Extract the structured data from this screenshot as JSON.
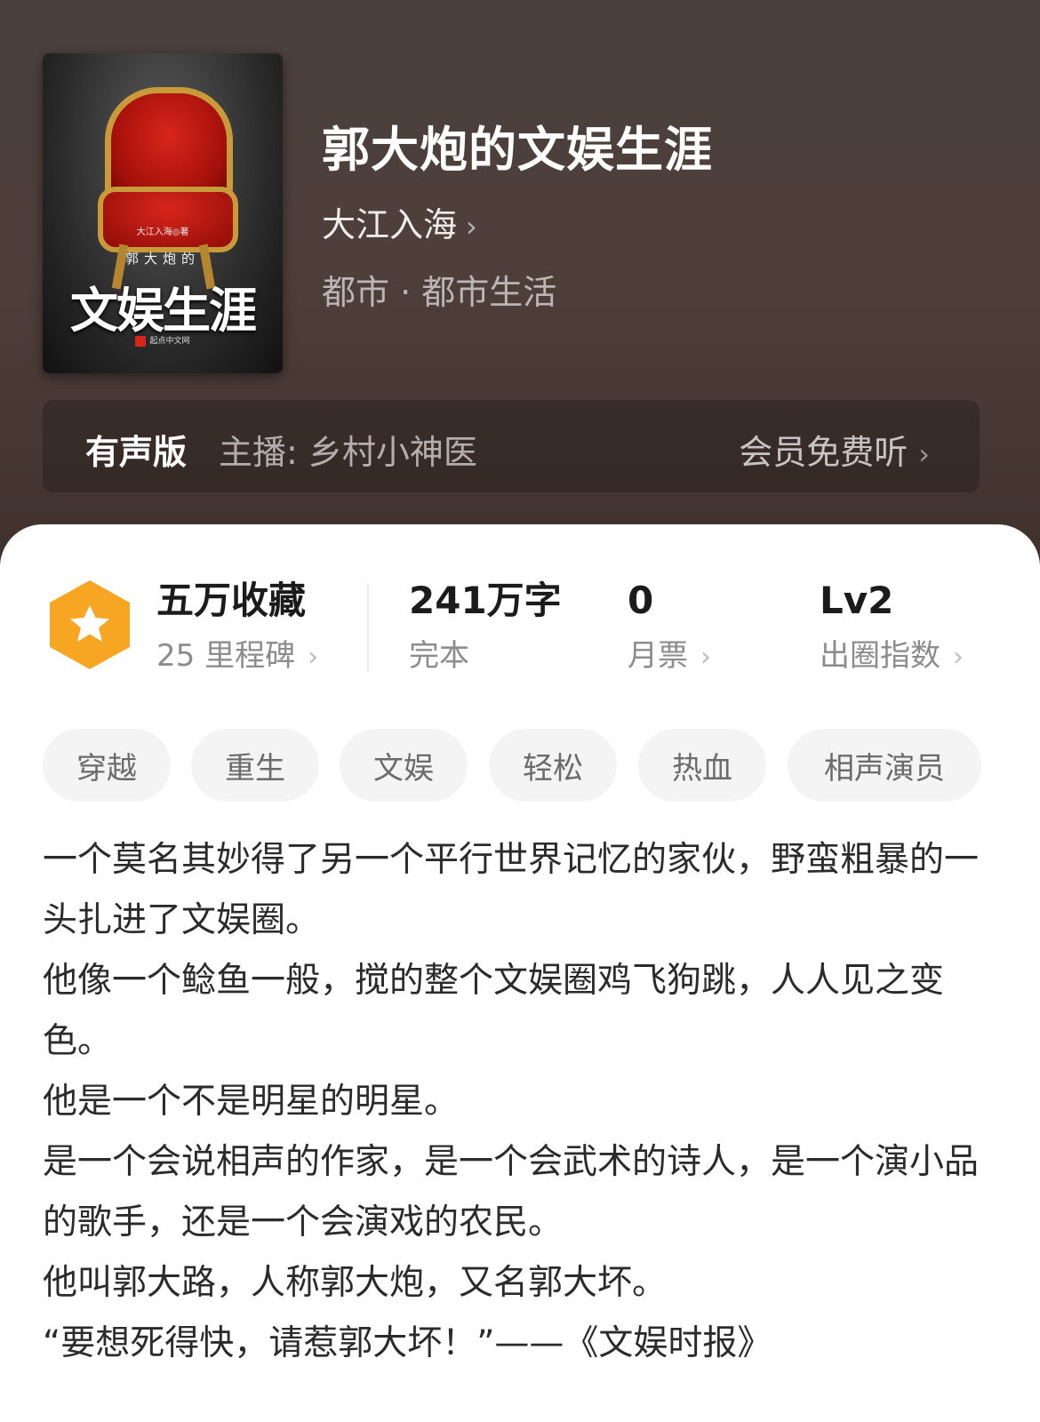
{
  "book": {
    "cover": {
      "author_line": "大江入海◎著",
      "subtitle": "郭大炮的",
      "title": "文娱生涯",
      "publisher": "起点中文网"
    },
    "title": "郭大炮的文娱生涯",
    "author": "大江入海",
    "genre": "都市 · 都市生活"
  },
  "audio": {
    "label": "有声版",
    "host": "主播:  乡村小神医",
    "cta": "会员免费听"
  },
  "stats": {
    "favorites": {
      "value": "五万收藏",
      "label": "25 里程碑",
      "icon": "star-hexagon-icon"
    },
    "words": {
      "value": "241万字",
      "label": "完本"
    },
    "monthly_votes": {
      "value": "0",
      "label": "月票"
    },
    "popularity": {
      "value": "Lv2",
      "label": "出圈指数"
    }
  },
  "tags": [
    "穿越",
    "重生",
    "文娱",
    "轻松",
    "热血",
    "相声演员"
  ],
  "description": [
    "一个莫名其妙得了另一个平行世界记忆的家伙，野蛮粗暴的一头扎进了文娱圈。",
    "他像一个鲶鱼一般，搅的整个文娱圈鸡飞狗跳，人人见之变色。",
    "他是一个不是明星的明星。",
    "是一个会说相声的作家，是一个会武术的诗人，是一个演小品的歌手，还是一个会演戏的农民。",
    "他叫郭大路，人称郭大炮，又名郭大坏。",
    "“要想死得快，请惹郭大坏！”——《文娱时报》"
  ],
  "colors": {
    "header_bg": "#4a403d",
    "badge_orange": "#f6a623",
    "tag_bg": "#f4f4f4"
  }
}
